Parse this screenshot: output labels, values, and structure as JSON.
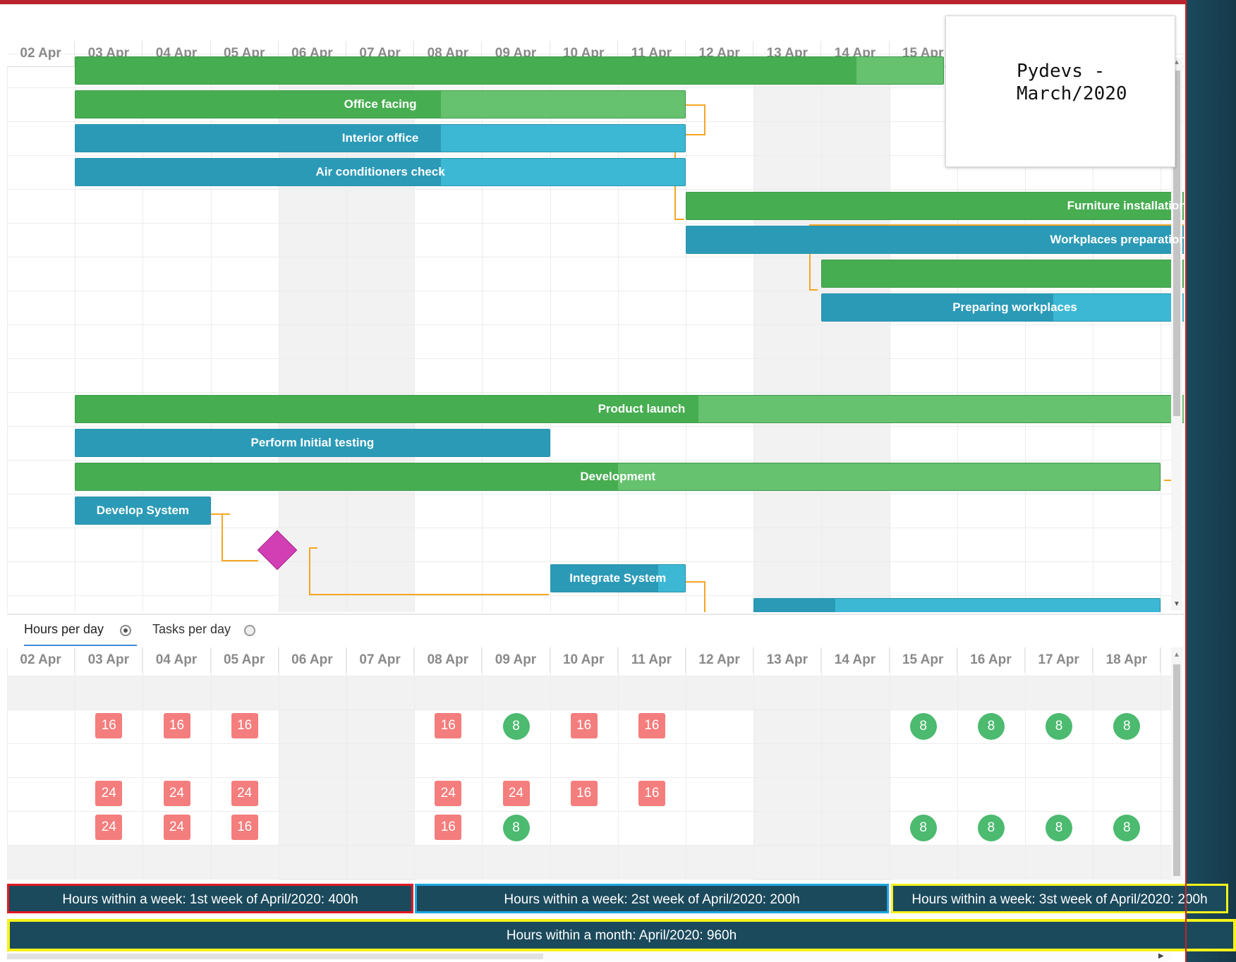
{
  "top_scale": [
    "02 Apr",
    "03 Apr",
    "04 Apr",
    "05 Apr",
    "06 Apr",
    "07 Apr",
    "08 Apr",
    "09 Apr",
    "10 Apr",
    "11 Apr",
    "12 Apr",
    "13 Apr",
    "14 Apr",
    "15 Apr"
  ],
  "bottom_scale": [
    "02 Apr",
    "03 Apr",
    "04 Apr",
    "05 Apr",
    "06 Apr",
    "07 Apr",
    "08 Apr",
    "09 Apr",
    "10 Apr",
    "11 Apr",
    "12 Apr",
    "13 Apr",
    "14 Apr",
    "15 Apr",
    "16 Apr",
    "17 Apr",
    "18 Apr"
  ],
  "popup": {
    "title": "Pydevs - March/2020"
  },
  "bars": [
    {
      "row": 0,
      "start": 1,
      "end": 13.8,
      "color": "green",
      "progress": 0.9,
      "label": ""
    },
    {
      "row": 1,
      "start": 1,
      "end": 10,
      "color": "green",
      "progress": 0.6,
      "label": "Office facing"
    },
    {
      "row": 2,
      "start": 1,
      "end": 10,
      "color": "blue",
      "progress": 0.6,
      "label": "Interior office"
    },
    {
      "row": 3,
      "start": 1,
      "end": 10,
      "color": "blue",
      "progress": 0.6,
      "label": "Air conditioners check"
    },
    {
      "row": 4,
      "start": 10,
      "end": 17.7,
      "color": "green",
      "progress": 1,
      "label": "Furniture installation"
    },
    {
      "row": 5,
      "start": 10,
      "end": 17.7,
      "color": "blue",
      "progress": 1,
      "label": "Workplaces preparation"
    },
    {
      "row": 6,
      "start": 12,
      "end": 17.7,
      "color": "green",
      "progress": 1,
      "label": ""
    },
    {
      "row": 7,
      "start": 12,
      "end": 17.7,
      "color": "blue",
      "progress": 0.6,
      "label": "Preparing workplaces"
    },
    {
      "row": 10,
      "start": 1,
      "end": 17.7,
      "color": "green",
      "progress": 0.55,
      "label": "Product launch"
    },
    {
      "row": 11,
      "start": 1,
      "end": 8,
      "color": "blue",
      "progress": 1,
      "label": "Perform Initial testing"
    },
    {
      "row": 12,
      "start": 1,
      "end": 17,
      "color": "green",
      "progress": 0.5,
      "label": "Development"
    },
    {
      "row": 13,
      "start": 1,
      "end": 3,
      "color": "blue",
      "progress": 1,
      "label": "Develop System"
    },
    {
      "row": 15,
      "start": 8,
      "end": 10,
      "color": "blue",
      "progress": 0.8,
      "label": "Integrate System"
    },
    {
      "row": 16,
      "start": 11,
      "end": 17,
      "color": "blue",
      "progress": 0.2,
      "label": ""
    }
  ],
  "tabs": [
    {
      "label": "Hours per day",
      "selected": true
    },
    {
      "label": "Tasks per day",
      "selected": false
    }
  ],
  "resource_rows": [
    {
      "row": 1,
      "items": [
        {
          "col": 1,
          "v": "16",
          "k": "over"
        },
        {
          "col": 2,
          "v": "16",
          "k": "over"
        },
        {
          "col": 3,
          "v": "16",
          "k": "over"
        },
        {
          "col": 6,
          "v": "16",
          "k": "over"
        },
        {
          "col": 7,
          "v": "8",
          "k": "ok"
        },
        {
          "col": 8,
          "v": "16",
          "k": "over"
        },
        {
          "col": 9,
          "v": "16",
          "k": "over"
        },
        {
          "col": 13,
          "v": "8",
          "k": "ok"
        },
        {
          "col": 14,
          "v": "8",
          "k": "ok"
        },
        {
          "col": 15,
          "v": "8",
          "k": "ok"
        },
        {
          "col": 16,
          "v": "8",
          "k": "ok"
        }
      ]
    },
    {
      "row": 3,
      "items": [
        {
          "col": 1,
          "v": "24",
          "k": "over"
        },
        {
          "col": 2,
          "v": "24",
          "k": "over"
        },
        {
          "col": 3,
          "v": "24",
          "k": "over"
        },
        {
          "col": 6,
          "v": "24",
          "k": "over"
        },
        {
          "col": 7,
          "v": "24",
          "k": "over"
        },
        {
          "col": 8,
          "v": "16",
          "k": "over"
        },
        {
          "col": 9,
          "v": "16",
          "k": "over"
        }
      ]
    },
    {
      "row": 4,
      "items": [
        {
          "col": 1,
          "v": "24",
          "k": "over"
        },
        {
          "col": 2,
          "v": "24",
          "k": "over"
        },
        {
          "col": 3,
          "v": "16",
          "k": "over"
        },
        {
          "col": 6,
          "v": "16",
          "k": "over"
        },
        {
          "col": 7,
          "v": "8",
          "k": "ok"
        },
        {
          "col": 13,
          "v": "8",
          "k": "ok"
        },
        {
          "col": 14,
          "v": "8",
          "k": "ok"
        },
        {
          "col": 15,
          "v": "8",
          "k": "ok"
        },
        {
          "col": 16,
          "v": "8",
          "k": "ok"
        }
      ]
    }
  ],
  "summaries": {
    "week1": "Hours within a week: 1st week of April/2020: 400h",
    "week2": "Hours within a week: 2st week of April/2020: 200h",
    "week3": "Hours within a week: 3st week of April/2020: 200h",
    "month": "Hours within a month: April/2020:  960h"
  },
  "colors": {
    "green_task": "#47ad51",
    "blue_task": "#2b9ab7",
    "milestone": "#d23fb5",
    "link": "#f5a623",
    "overload": "#f47d7d",
    "normal": "#4cba6f",
    "summary_bg": "#1b4a5c",
    "border_red": "#e01b24",
    "border_blue": "#1fa6e0",
    "border_yellow": "#f5f21c"
  }
}
